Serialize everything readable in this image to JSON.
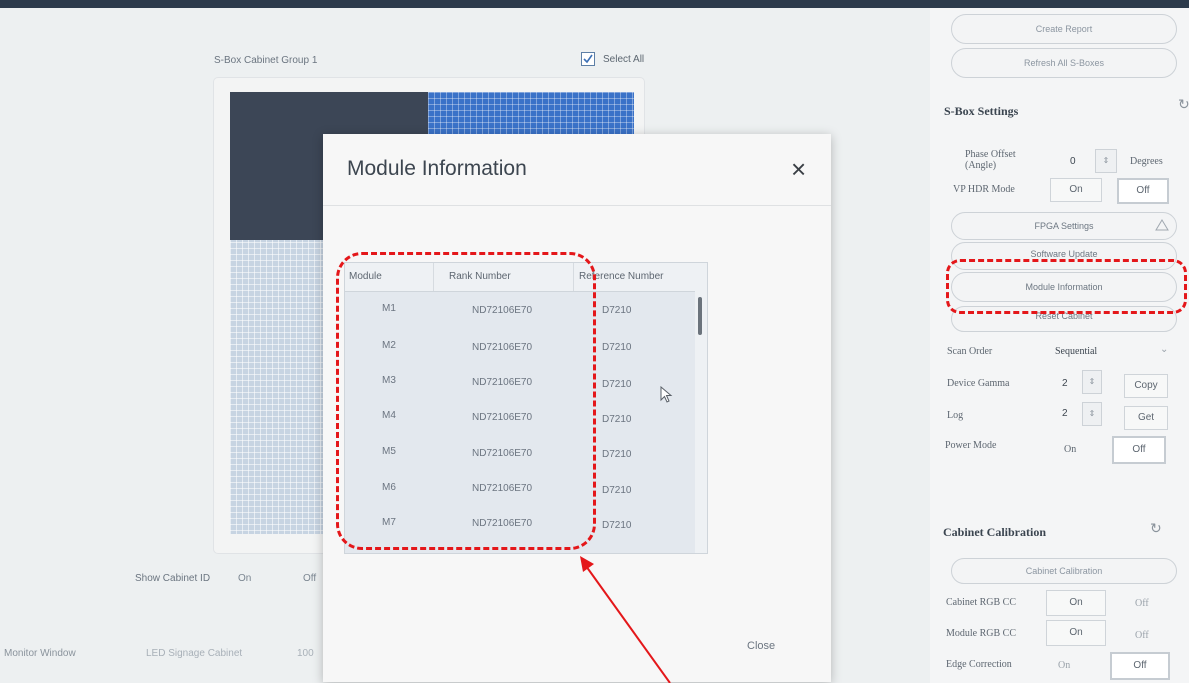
{
  "cabinet": {
    "group_label": "S-Box Cabinet Group 1",
    "select_all_label": "Select All",
    "show_cabinet_id_label": "Show Cabinet ID",
    "show_on": "On",
    "show_off": "Off"
  },
  "bottom": {
    "monitor_window_label": "Monitor Window",
    "cabinet_select": "LED Signage Cabinet",
    "value": "100"
  },
  "modal": {
    "title": "Module Information",
    "close_icon": "×",
    "close_label": "Close",
    "columns": [
      "Module",
      "Rank Number",
      "Reference Number"
    ],
    "rows": [
      [
        "M1",
        "ND72106E70",
        "D7210"
      ],
      [
        "M2",
        "ND72106E70",
        "D7210"
      ],
      [
        "M3",
        "ND72106E70",
        "D7210"
      ],
      [
        "M4",
        "ND72106E70",
        "D7210"
      ],
      [
        "M5",
        "ND72106E70",
        "D7210"
      ],
      [
        "M6",
        "ND72106E70",
        "D7210"
      ],
      [
        "M7",
        "ND72106E70",
        "D7210"
      ]
    ]
  },
  "panel": {
    "create_report": "Create Report",
    "refresh_all": "Refresh All S-Boxes",
    "sbox_settings": "S-Box Settings",
    "phase_offset_label": "Phase Offset (Angle)",
    "phase_offset_value": "0",
    "phase_offset_unit": "Degrees",
    "vp_hdr_label": "VP HDR Mode",
    "on": "On",
    "off": "Off",
    "fpga_settings": "FPGA Settings",
    "software_update": "Software Update",
    "module_information": "Module Information",
    "reset_cabinet": "Reset Cabinet",
    "scan_order_label": "Scan Order",
    "scan_order_value": "Sequential",
    "device_gamma_label": "Device Gamma",
    "device_gamma_value": "2",
    "copy": "Copy",
    "log_label": "Log",
    "log_value": "2",
    "get": "Get",
    "power_mode_label": "Power Mode",
    "cabinet_calibration_title": "Cabinet Calibration",
    "cabinet_calibration_button": "Cabinet Calibration",
    "cabinet_rgb_cc": "Cabinet RGB CC",
    "module_rgb_cc": "Module RGB CC",
    "edge_correction": "Edge Correction"
  },
  "colors": {
    "annotation": "#e4171a",
    "accent": "#3a72c8"
  }
}
